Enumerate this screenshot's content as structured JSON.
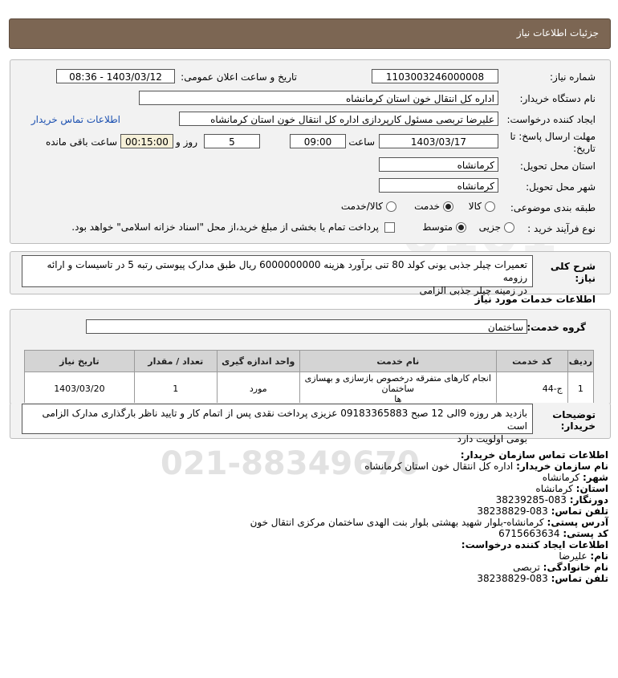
{
  "header": {
    "title": "جزئیات اطلاعات نیاز"
  },
  "form": {
    "need_number_label": "شماره نیاز:",
    "need_number": "1103003246000008",
    "announce_label": "تاریخ و ساعت اعلان عمومی:",
    "announce_value": "1403/03/12 - 08:36",
    "buyer_org_label": "نام دستگاه خریدار:",
    "buyer_org": "اداره کل انتقال خون استان کرمانشاه",
    "creator_label": "ایجاد کننده درخواست:",
    "creator": "علیرضا تربصی مسئول کارپردازی اداره کل انتقال خون استان کرمانشاه",
    "buyer_contact_link": "اطلاعات تماس خریدار",
    "deadline_label_1": "مهلت ارسال پاسخ: تا",
    "deadline_label_2": "تاریخ:",
    "deadline_date": "1403/03/17",
    "time_label": "ساعت",
    "deadline_time": "09:00",
    "days_value": "5",
    "days_label": "روز و",
    "remaining_time": "00:15:00",
    "remaining_label": "ساعت باقی مانده",
    "province_label": "استان محل تحویل:",
    "province": "کرمانشاه",
    "city_label": "شهر محل تحویل:",
    "city": "کرمانشاه",
    "category_label": "طبقه بندی موضوعی:",
    "category_options": [
      "کالا",
      "خدمت",
      "کالا/خدمت"
    ],
    "category_selected": "خدمت",
    "process_label": "نوع فرآیند خرید :",
    "process_options": [
      "جزیی",
      "متوسط"
    ],
    "process_selected": "متوسط",
    "payment_note": "پرداخت تمام یا بخشی از مبلغ خرید،از محل \"اسناد خزانه اسلامی\" خواهد بود."
  },
  "summary": {
    "label": "شرح کلی نیاز:",
    "text_line1": "تعمیرات چیلر جذبی یونی کولد 80 تنی برآورد هزینه 6000000000 ریال طبق مدارک پیوستی رتبه 5 در تاسیسات و ارائه رزومه",
    "text_line2": "در زمینه چیلر جذبی الزامی"
  },
  "services": {
    "section_title": "اطلاعات خدمات مورد نیاز",
    "group_label": "گروه خدمت:",
    "group_value": "ساختمان"
  },
  "table": {
    "headers": [
      "ردیف",
      "کد خدمت",
      "نام خدمت",
      "واحد اندازه گیری",
      "تعداد / مقدار",
      "تاریخ نیاز"
    ],
    "rows": [
      {
        "index": "1",
        "code": "ج-44",
        "name_line1": "انجام کارهای متفرقه درخصوص بازسازی و بهسازی ساختمان",
        "name_line2": "ها",
        "unit": "مورد",
        "qty": "1",
        "date": "1403/03/20"
      }
    ]
  },
  "buyer_notes": {
    "label_line1": "توضیحات",
    "label_line2": "خریدار:",
    "line1": "بازدید هر روزه 9الی 12 صبح 09183365883 عزیزی پرداخت نقدی پس از اتمام کار و تایید ناظر بارگذاری مدارک الزامی است",
    "line2": "بومی اولویت دارد"
  },
  "contact": {
    "title": "اطلاعات تماس سازمان خریدار:",
    "org_key": "نام سازمان خریدار:",
    "org_val": "اداره کل انتقال خون استان کرمانشاه",
    "city_key": "شهر:",
    "city_val": "کرمانشاه",
    "province_key": "استان:",
    "province_val": "کرمانشاه",
    "fax_key": "دورنگار:",
    "fax_val": "083-38239285",
    "phone_key": "تلفن تماس:",
    "phone_val": "083-38238829",
    "address_key": "آدرس پستی:",
    "address_val": "کرمانشاه-بلوار شهید بهشتی بلوار بنت الهدی ساختمان مرکزی انتقال خون",
    "postal_key": "کد پستی:",
    "postal_val": "6715663634",
    "creator_title": "اطلاعات ایجاد کننده درخواست:",
    "name_key": "نام:",
    "name_val": "علیرضا",
    "family_key": "نام خانوادگی:",
    "family_val": "تربصی",
    "cphone_key": "تلفن تماس:",
    "cphone_val": "083-38238829"
  }
}
